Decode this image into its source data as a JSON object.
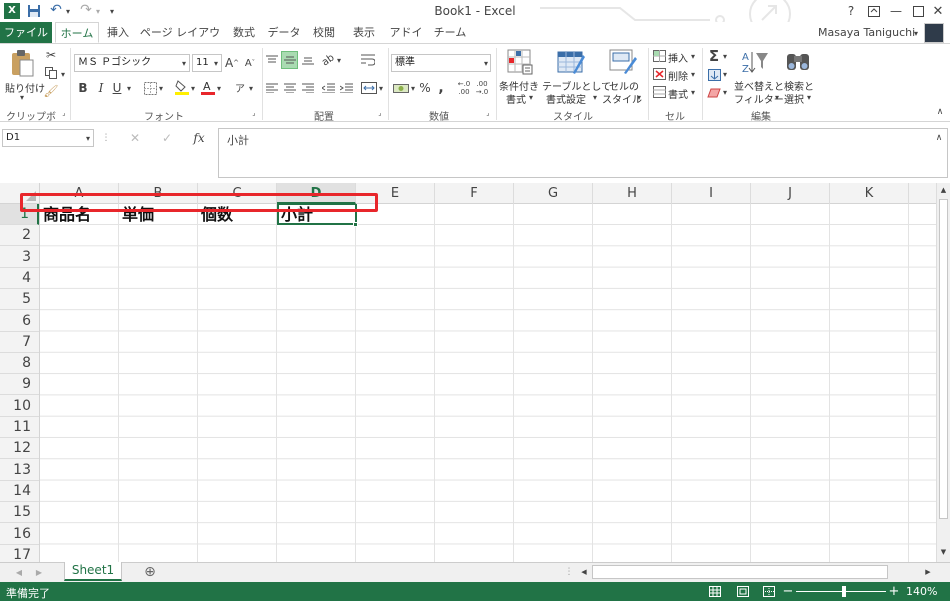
{
  "window": {
    "title": "Book1 - Excel",
    "user": "Masaya Taniguchi"
  },
  "tabs": [
    "ファイル",
    "ホーム",
    "挿入",
    "ページ レイアウト",
    "数式",
    "データ",
    "校閲",
    "表示",
    "アドイン",
    "チーム"
  ],
  "ribbon": {
    "clipboard": {
      "paste": "貼り付け",
      "label": "クリップボード"
    },
    "font": {
      "name": "ＭＳ Ｐゴシック",
      "size": "11",
      "label": "フォント",
      "bold": "B",
      "italic": "I",
      "underline": "U"
    },
    "alignment": {
      "label": "配置"
    },
    "number": {
      "format": "標準",
      "label": "数値",
      "percent": "%"
    },
    "styles": {
      "conditional": [
        "条件付き",
        "書式"
      ],
      "table": [
        "テーブルとして",
        "書式設定"
      ],
      "cell": [
        "セルの",
        "スタイル"
      ],
      "label": "スタイル"
    },
    "cells": {
      "insert": "挿入",
      "delete": "削除",
      "format": "書式",
      "label": "セル"
    },
    "editing": {
      "sort": [
        "並べ替えと",
        "フィルター"
      ],
      "find": [
        "検索と",
        "選択"
      ],
      "label": "編集"
    }
  },
  "formula_bar": {
    "name_box": "D1",
    "fx": "fx",
    "content": "小計"
  },
  "columns": [
    "A",
    "B",
    "C",
    "D",
    "E",
    "F",
    "G",
    "H",
    "I",
    "J",
    "K"
  ],
  "rows": [
    "1",
    "2",
    "3",
    "4",
    "5",
    "6",
    "7",
    "8",
    "9",
    "10",
    "11",
    "12",
    "13",
    "14",
    "15",
    "16",
    "17"
  ],
  "cells": {
    "A1": "商品名",
    "B1": "単価",
    "C1": "個数",
    "D1": "小計"
  },
  "sheet": {
    "tab": "Sheet1",
    "add": "⊕"
  },
  "status": {
    "text": "準備完了",
    "zoom": "140%"
  },
  "colors": {
    "accent": "#217346",
    "highlight": "#e8262b"
  }
}
